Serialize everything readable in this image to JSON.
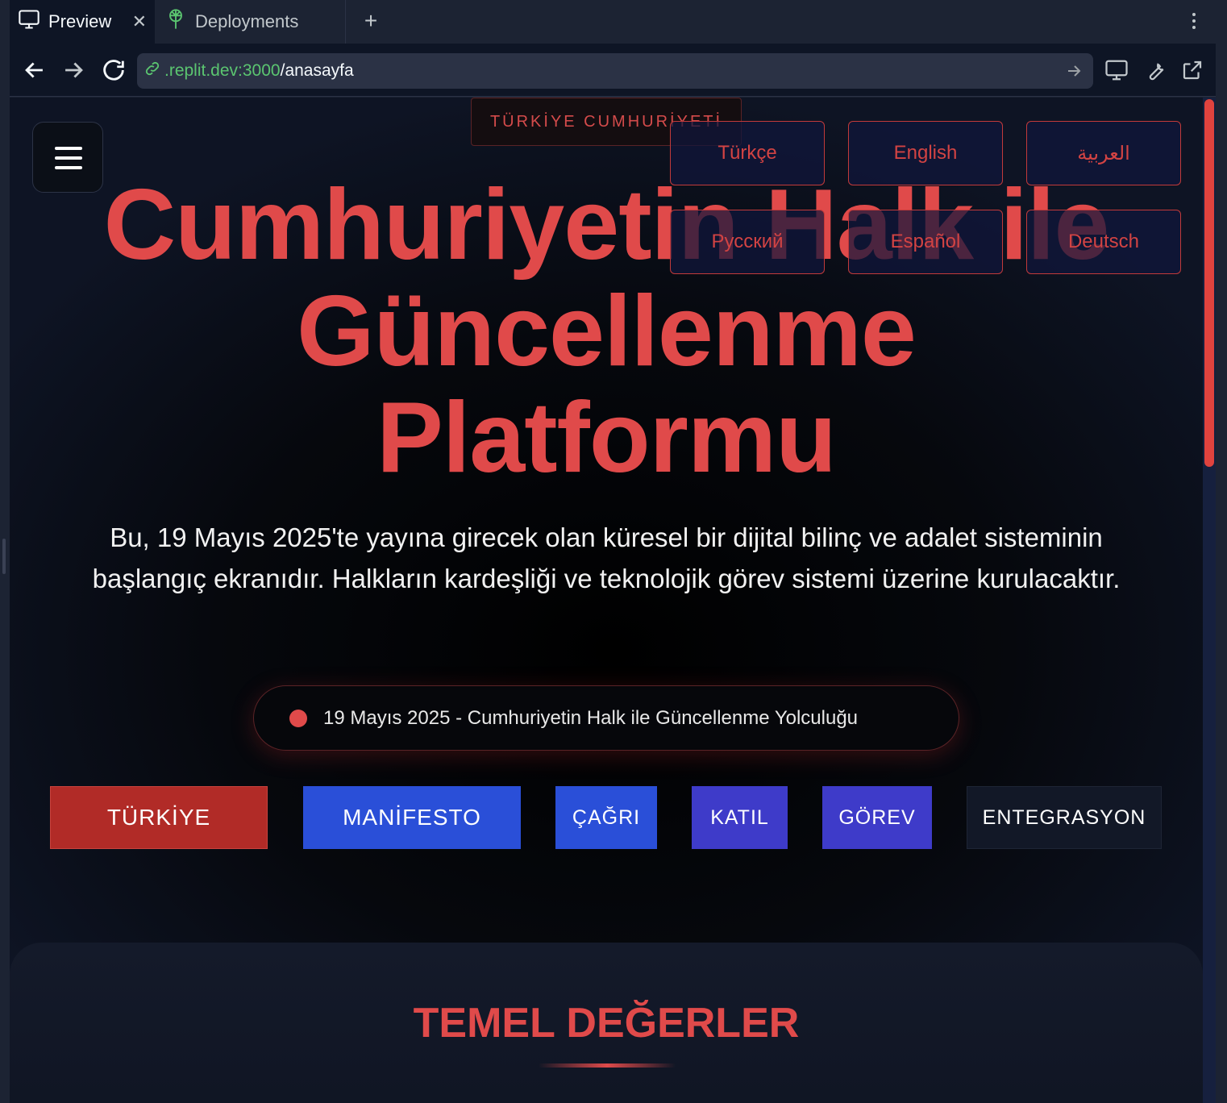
{
  "chrome": {
    "tabs": [
      {
        "label": "Preview",
        "icon": "monitor-icon",
        "active": true
      },
      {
        "label": "Deployments",
        "icon": "deploy-icon",
        "active": false
      }
    ],
    "url": {
      "host": ".replit.dev:3000",
      "path": "/anasayfa"
    }
  },
  "page": {
    "country_tag": "TÜRKİYE CUMHURİYETİ",
    "title_lines": [
      "Cumhuriyetin Halk ile",
      "Güncellenme",
      "Platformu"
    ],
    "languages": [
      "Türkçe",
      "English",
      "العربية",
      "Русский",
      "Español",
      "Deutsch"
    ],
    "description": "Bu, 19 Mayıs 2025'te yayına girecek olan küresel bir dijital bilinç ve adalet sisteminin başlangıç ekranıdır. Halkların kardeşliği ve teknolojik görev sistemi üzerine kurulacaktır.",
    "date_pill": "19 Mayıs 2025 - Cumhuriyetin Halk ile Güncellenme Yolculuğu",
    "buttons": [
      {
        "label": "TÜRKİYE",
        "color": "#b12b27"
      },
      {
        "label": "MANİFESTO",
        "color": "#2a4fd8"
      },
      {
        "label": "ÇAĞRI",
        "color": "#2a4fd8"
      },
      {
        "label": "KATIL",
        "color": "#3e3bc9"
      },
      {
        "label": "GÖREV",
        "color": "#3e3bc9"
      },
      {
        "label": "ENTEGRASYON",
        "color": "#121827"
      }
    ],
    "values_title": "TEMEL DEĞERLER"
  },
  "colors": {
    "accent": "#e04a4a",
    "background": "#000000",
    "chrome": "#1c2333"
  }
}
